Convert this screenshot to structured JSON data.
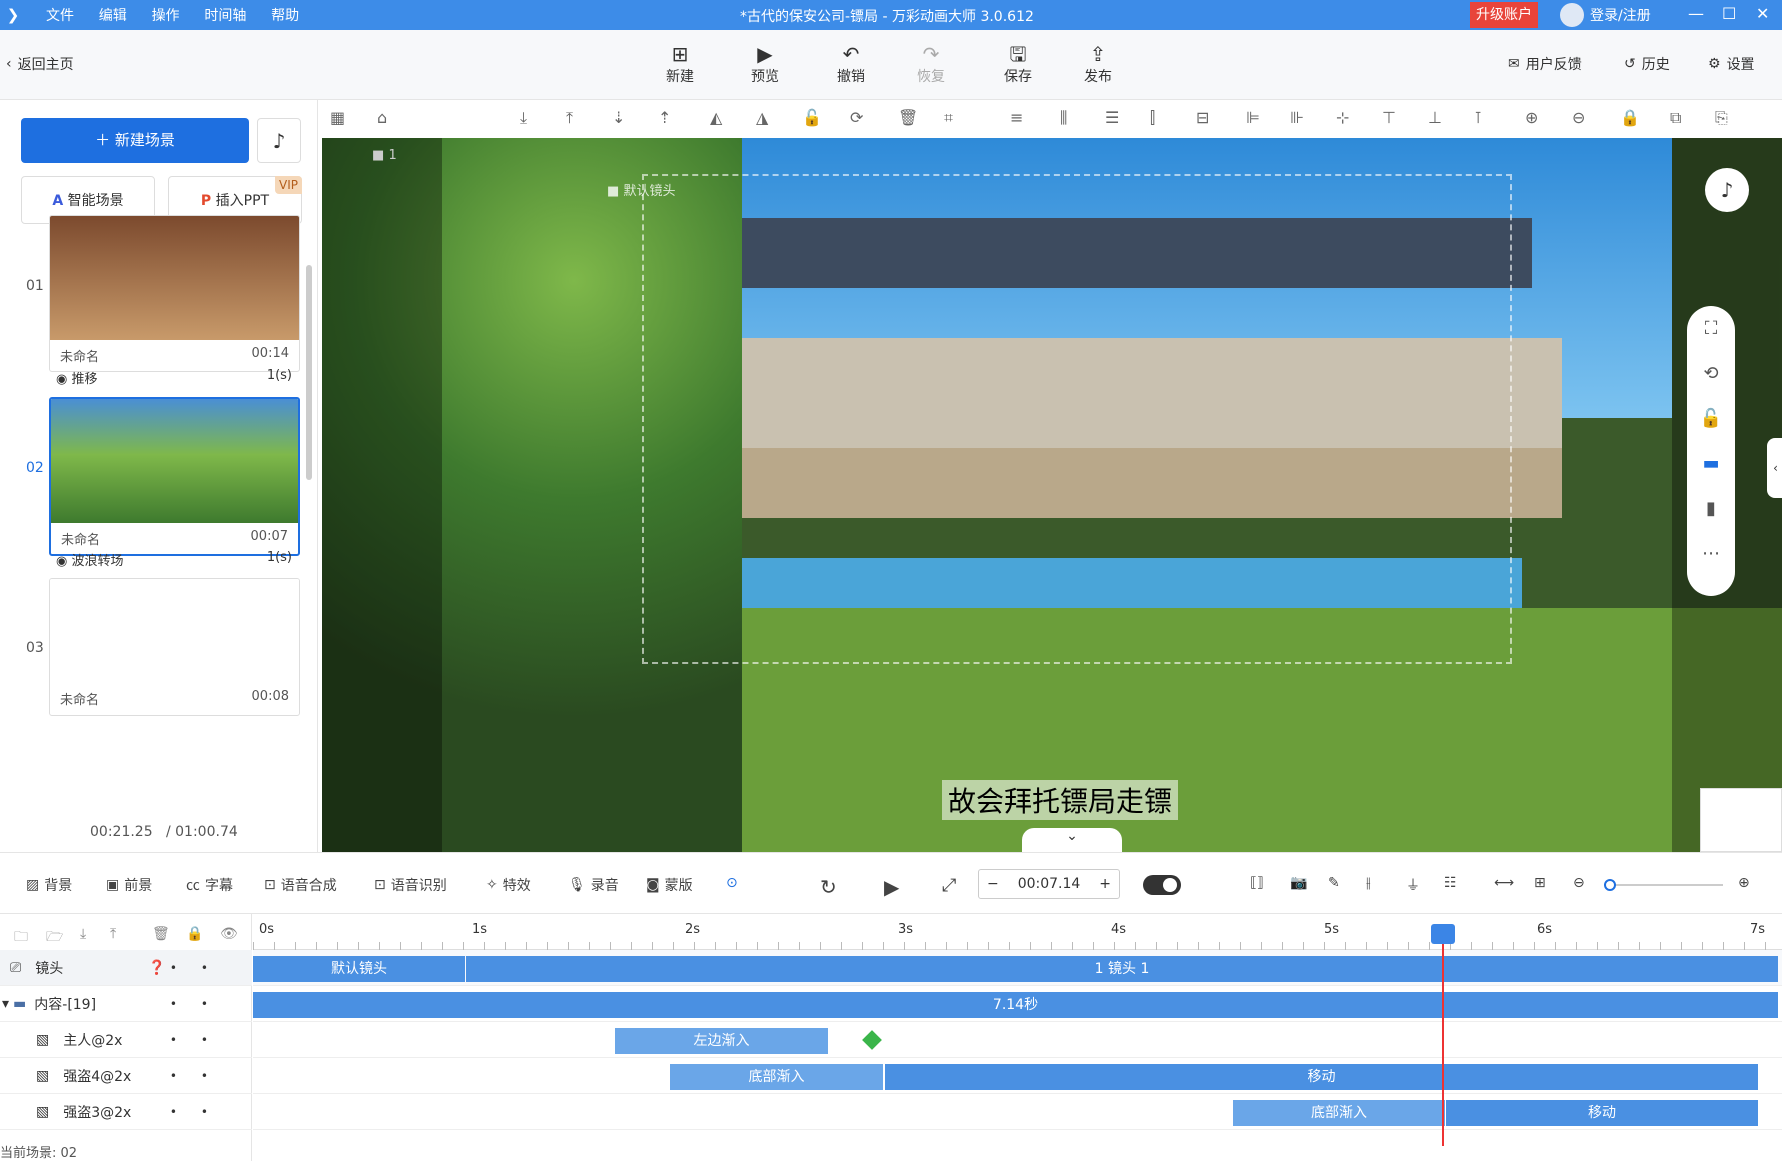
{
  "app": {
    "menu": [
      "文件",
      "编辑",
      "操作",
      "时间轴",
      "帮助"
    ],
    "title": "*古代的保安公司-镖局 - 万彩动画大师 3.0.612",
    "upgrade": "升级账户",
    "login": "登录/注册"
  },
  "toolbar": {
    "back": "返回主页",
    "new": "新建",
    "preview": "预览",
    "undo": "撤销",
    "redo": "恢复",
    "save": "保存",
    "publish": "发布",
    "feedback": "用户反馈",
    "history": "历史",
    "settings": "设置"
  },
  "left": {
    "new_scene": "新建场景",
    "smart_scene": "智能场景",
    "insert_ppt": "插入PPT",
    "vip": "VIP",
    "scenes": [
      {
        "num": "01",
        "name": "未命名",
        "duration": "00:14"
      },
      {
        "num": "02",
        "name": "未命名",
        "duration": "00:07"
      },
      {
        "num": "03",
        "name": "未命名",
        "duration": "00:08"
      }
    ],
    "transitions": [
      {
        "name": "推移",
        "duration": "1(s)"
      },
      {
        "name": "波浪转场",
        "duration": "1(s)"
      }
    ],
    "current_time": "00:21.25",
    "total_time": "/ 01:00.74"
  },
  "canvas": {
    "subtitle": "故会拜托镖局走镖",
    "camera_index": "1",
    "camera_default": "默认镜头"
  },
  "fx": {
    "items": [
      "背景",
      "前景",
      "字幕",
      "语音合成",
      "语音识别",
      "特效",
      "录音",
      "蒙版"
    ],
    "time": "00:07.14"
  },
  "timeline": {
    "ticks": [
      "0s",
      "1s",
      "2s",
      "3s",
      "4s",
      "5s",
      "6s",
      "7s"
    ],
    "rows": [
      {
        "label": "镜头"
      },
      {
        "label": "内容-[19]"
      },
      {
        "label": "主人@2x"
      },
      {
        "label": "强盗4@2x"
      },
      {
        "label": "强盗3@2x"
      }
    ],
    "clips": {
      "cam_default": "默认镜头",
      "cam_1": "1 镜头 1",
      "content": "7.14秒",
      "host_in": "左边渐入",
      "bandit4_in": "底部渐入",
      "bandit4_move": "移动",
      "bandit3_in": "底部渐入",
      "bandit3_move": "移动"
    },
    "status": "当前场景: 02"
  },
  "colors": {
    "accent": "#1e6fe0",
    "titlebar": "#3d8ce8",
    "upgrade": "#e8443a",
    "clip": "#4a90e2",
    "playhead": "#e33"
  }
}
